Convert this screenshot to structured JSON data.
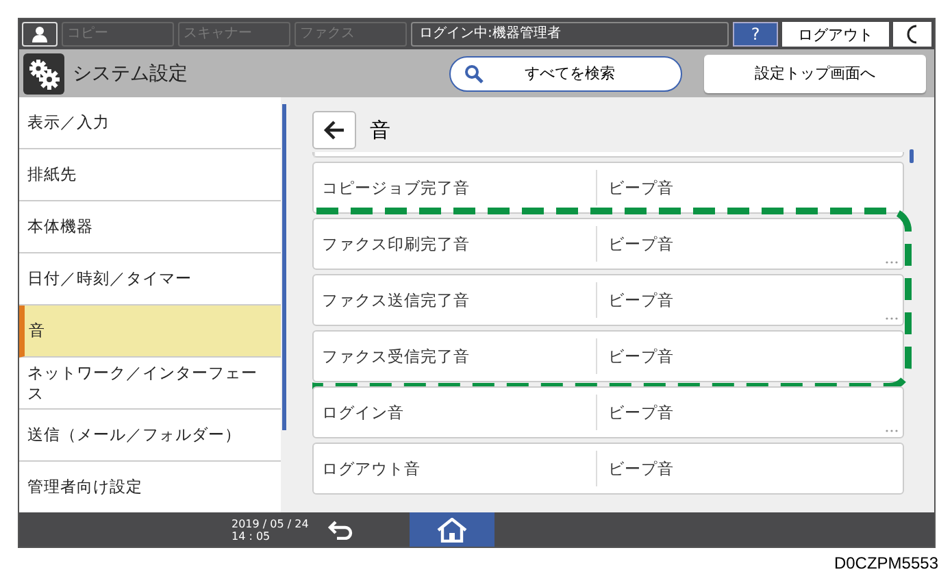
{
  "top_bar": {
    "modes": [
      {
        "label": "コピー",
        "disabled": true
      },
      {
        "label": "スキャナー",
        "disabled": true
      },
      {
        "label": "ファクス",
        "disabled": true
      }
    ],
    "login_status": "ログイン中:機器管理者",
    "help": "?",
    "logout": "ログアウト"
  },
  "header": {
    "title": "システム設定",
    "search": "すべてを検索",
    "top_button": "設定トップ画面へ"
  },
  "sidebar": {
    "items": [
      {
        "label": "表示／入力",
        "selected": false
      },
      {
        "label": "排紙先",
        "selected": false
      },
      {
        "label": "本体機器",
        "selected": false
      },
      {
        "label": "日付／時刻／タイマー",
        "selected": false
      },
      {
        "label": "音",
        "selected": true
      },
      {
        "label": "ネットワーク／インターフェース",
        "selected": false
      },
      {
        "label": "送信（メール／フォルダー）",
        "selected": false
      },
      {
        "label": "管理者向け設定",
        "selected": false
      }
    ]
  },
  "page": {
    "title": "音",
    "rows": [
      {
        "kind": "row",
        "name": "コピージョブ完了音",
        "value": "ビープ音",
        "more": false
      },
      {
        "kind": "highlight",
        "rows": [
          {
            "kind": "row",
            "name": "ファクス印刷完了音",
            "value": "ビープ音",
            "more": true
          },
          {
            "kind": "row",
            "name": "ファクス送信完了音",
            "value": "ビープ音",
            "more": true
          },
          {
            "kind": "row",
            "name": "ファクス受信完了音",
            "value": "ビープ音",
            "more": false
          }
        ]
      },
      {
        "kind": "row",
        "name": "ログイン音",
        "value": "ビープ音",
        "more": true
      },
      {
        "kind": "row",
        "name": "ログアウト音",
        "value": "ビープ音",
        "more": false
      }
    ]
  },
  "footer": {
    "date": "2019 / 05 / 24",
    "time": "14 : 05",
    "home_selected": true
  },
  "caption": "D0CZPM5553"
}
